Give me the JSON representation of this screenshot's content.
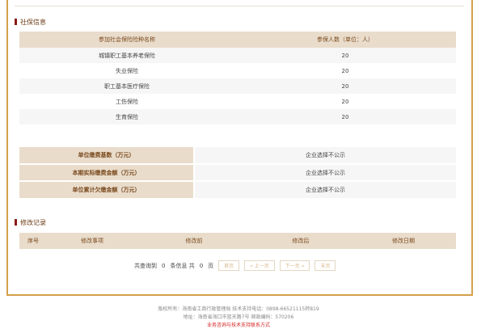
{
  "social": {
    "title": "社保信息",
    "col_type": "参加社会保险险种名称",
    "col_count": "参保人数（单位：人）",
    "rows": [
      {
        "type": "城镇职工基本养老保险",
        "count": "20"
      },
      {
        "type": "失业保险",
        "count": "20"
      },
      {
        "type": "职工基本医疗保险",
        "count": "20"
      },
      {
        "type": "工伤保险",
        "count": "20"
      },
      {
        "type": "生育保险",
        "count": "20"
      }
    ]
  },
  "payment": {
    "rows": [
      {
        "label": "单位缴费基数（万元）",
        "value": "企业选择不公示"
      },
      {
        "label": "本期实际缴费金额（万元）",
        "value": "企业选择不公示"
      },
      {
        "label": "单位累计欠缴金额（万元）",
        "value": "企业选择不公示"
      }
    ]
  },
  "changes": {
    "title": "修改记录",
    "headers": [
      "序号",
      "修改事项",
      "修改前",
      "修改后",
      "修改日期"
    ]
  },
  "pager": {
    "prefix": "共查询到",
    "total": "0",
    "mid": "条信息 共",
    "pages": "0",
    "suffix": "页",
    "first": "首页",
    "prev": "« 上一页",
    "next": "下一页 »",
    "last": "末页"
  },
  "footer": {
    "line1": "版权所有：海南省工商行政管理局 技术支持电话：0898-66521115转819",
    "line2": "地址：海南省海口市蓝天路7号 邮政编码：570206",
    "line3": "业务咨询与技术支持联系方式"
  }
}
